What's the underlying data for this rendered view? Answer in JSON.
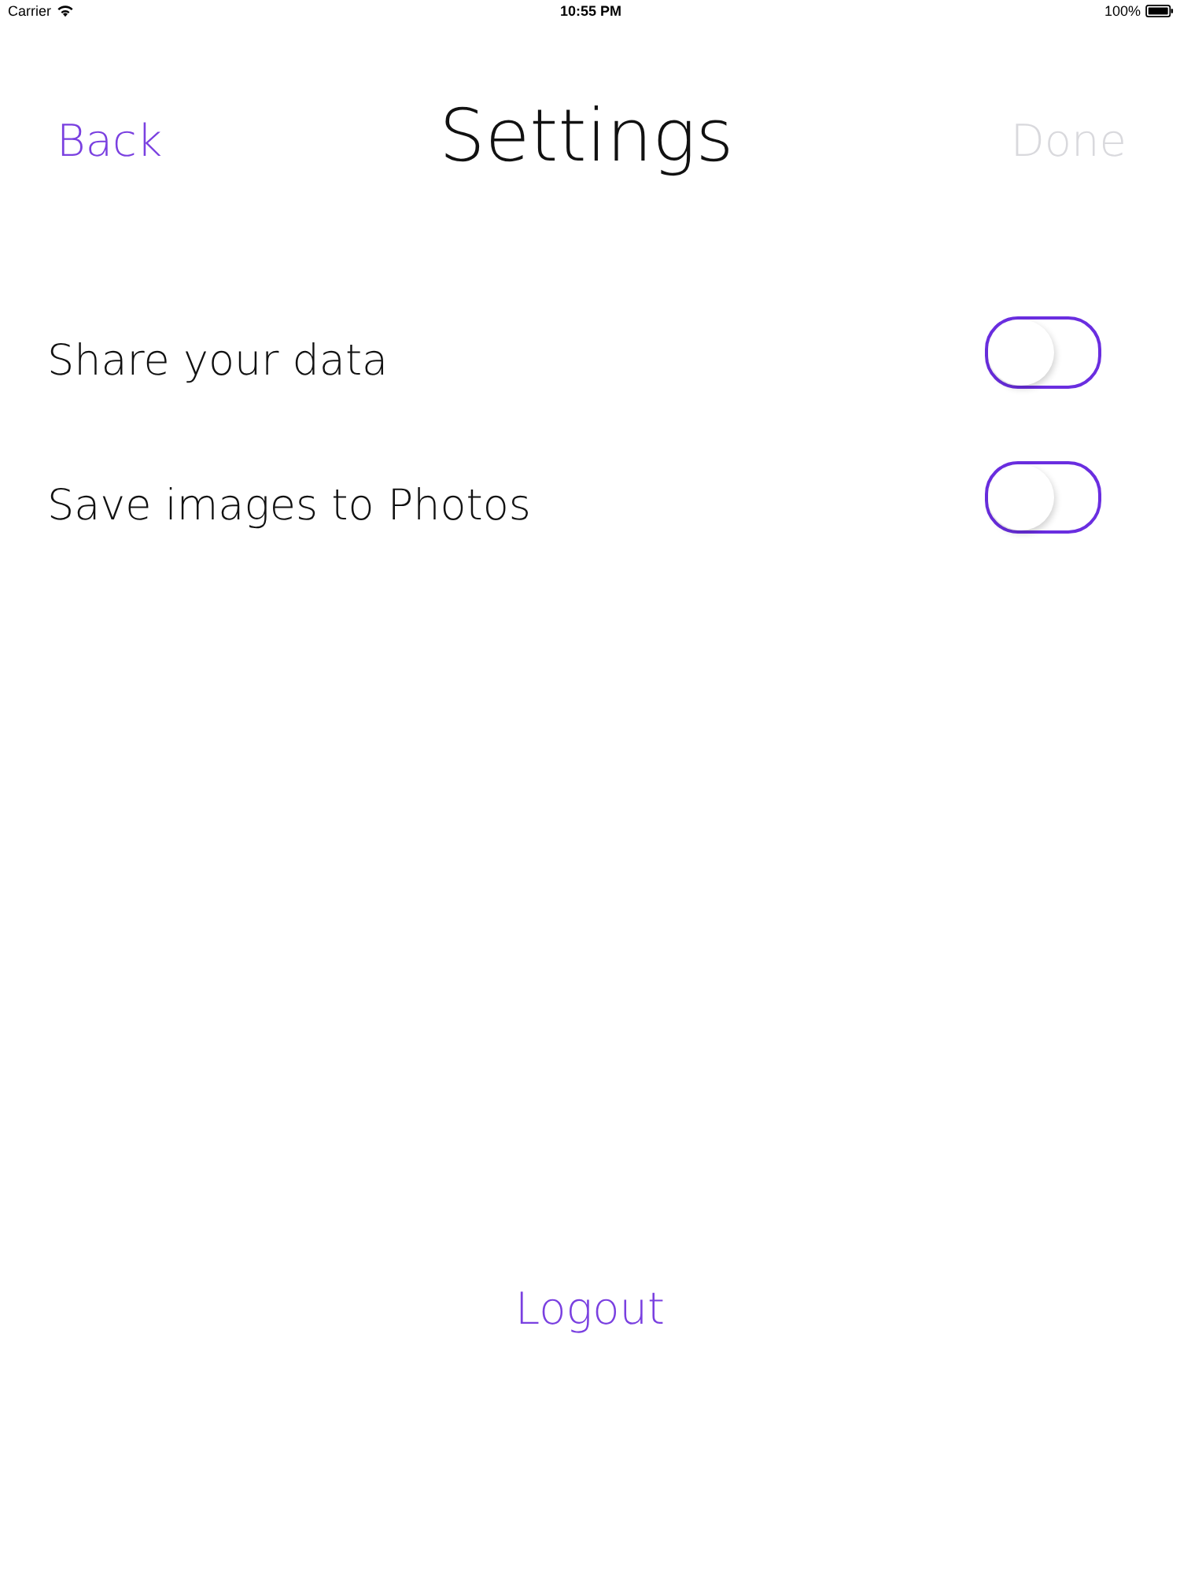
{
  "status_bar": {
    "carrier": "Carrier",
    "time": "10:55 PM",
    "battery": "100%"
  },
  "nav_bar": {
    "back": "Back",
    "title": "Settings",
    "done": {
      "label": "Done",
      "disabled": true
    }
  },
  "rows": [
    {
      "label": "Share your data",
      "on": false
    },
    {
      "label": "Save images to Photos",
      "on": false
    }
  ],
  "logout": "Logout"
}
